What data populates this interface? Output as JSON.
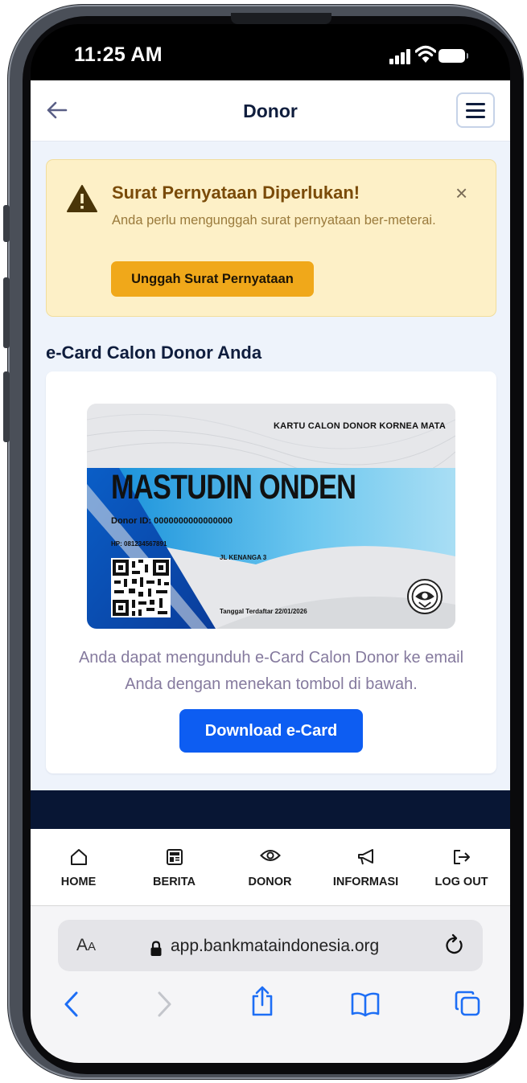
{
  "status_bar": {
    "time": "11:25 AM"
  },
  "header": {
    "title": "Donor"
  },
  "alert": {
    "title": "Surat Pernyataan Diperlukan!",
    "close_glyph": "×",
    "body": "Anda perlu mengunggah surat pernyataan ber-meterai.",
    "button_label": "Unggah Surat Pernyataan"
  },
  "ecard_section": {
    "title": "e-Card Calon Donor Anda",
    "card": {
      "heading": "KARTU CALON DONOR KORNEA MATA",
      "name": "MASTUDIN ONDEN",
      "donor_id": "Donor ID: 0000000000000000",
      "phone": "HP: 081234567891",
      "address": "JL KENANGA 3",
      "registered": "Tanggal Terdaftar 22/01/2026"
    },
    "description": "Anda dapat mengunduh e-Card Calon Donor ke email Anda dengan menekan tombol di bawah.",
    "download_label": "Download e-Card"
  },
  "bottom_nav": [
    {
      "label": "HOME",
      "icon": "home-icon"
    },
    {
      "label": "BERITA",
      "icon": "newspaper-icon"
    },
    {
      "label": "DONOR",
      "icon": "eye-icon"
    },
    {
      "label": "INFORMASI",
      "icon": "megaphone-icon"
    },
    {
      "label": "LOG OUT",
      "icon": "logout-icon"
    }
  ],
  "browser": {
    "aa_label": "A",
    "aa_small": "A",
    "url": "app.bankmataindonesia.org"
  },
  "colors": {
    "primary": "#0d5df2",
    "alert_bg": "#fdf0c7",
    "alert_button": "#f0a81a",
    "navy": "#081634"
  }
}
